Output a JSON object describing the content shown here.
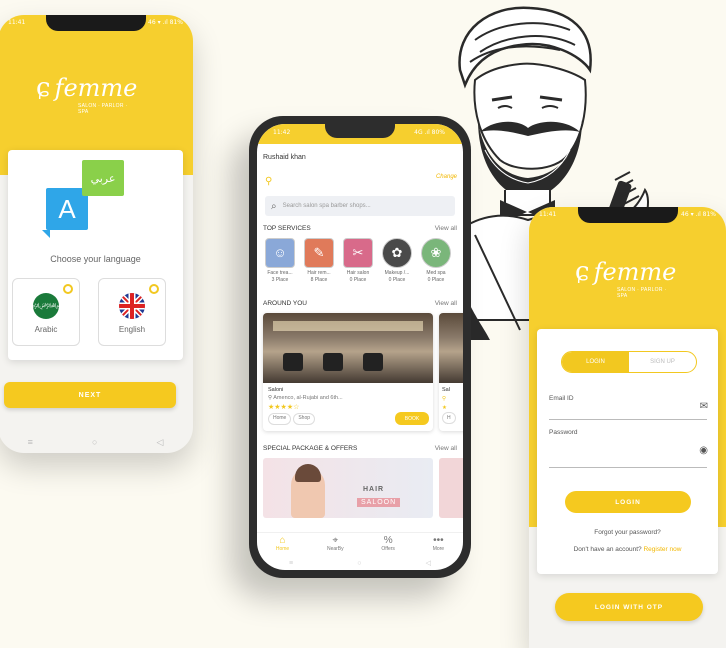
{
  "colors": {
    "accent": "#f6cf2e",
    "background": "#fcfaf1",
    "dark_frame": "#2d2d2d"
  },
  "brand": {
    "name": "femme",
    "tagline": "SALON · PARLOR · SPA"
  },
  "language_screen": {
    "status_left": "11:41",
    "status_right": "46 ▾ .ıl 81%",
    "translate_glyph_en": "A",
    "translate_glyph_ar": "عربي",
    "prompt": "Choose your language",
    "options": [
      {
        "label": "Arabic",
        "flag": "saudi-flag"
      },
      {
        "label": "English",
        "flag": "uk-flag"
      }
    ],
    "next_label": "NEXT"
  },
  "home_screen": {
    "status_left": "11:42",
    "status_right": "4G .ıl 80%",
    "user_name": "Rushaid khan",
    "change_label": "Change",
    "search_placeholder": "Search salon spa barber shops...",
    "top_services": {
      "title": "TOP SERVICES",
      "view_all": "View all",
      "items": [
        {
          "name": "Face trea...",
          "count": "3 Place",
          "color": "#8aa8d8"
        },
        {
          "name": "Hair rem...",
          "count": "8 Place",
          "color": "#e07a5a"
        },
        {
          "name": "Hair salon",
          "count": "0 Place",
          "color": "#d86a8a"
        },
        {
          "name": "Makeup /...",
          "count": "0 Place",
          "color": "#4a4a4a"
        },
        {
          "name": "Med spa",
          "count": "0 Place",
          "color": "#7ab67a"
        }
      ]
    },
    "around_you": {
      "title": "AROUND YOU",
      "view_all": "View all",
      "salon": {
        "name": "Saloni",
        "address": "Amenco, al-Rujabi and 6th...",
        "tags": [
          "Home",
          "Shop"
        ],
        "book_label": "BOOK"
      },
      "salon_partial": {
        "name": "Sal",
        "tag": "H"
      }
    },
    "special": {
      "title": "SPECIAL PACKAGE & OFFERS",
      "view_all": "View all",
      "banner_line1": "HAIR",
      "banner_line2": "SALOON"
    },
    "nav": [
      {
        "label": "Home",
        "icon": "home-icon"
      },
      {
        "label": "NearBy",
        "icon": "nearby-icon"
      },
      {
        "label": "Offers",
        "icon": "offers-icon"
      },
      {
        "label": "More",
        "icon": "more-icon"
      }
    ]
  },
  "login_screen": {
    "status_left": "11:41",
    "status_right": "46 ▾ .ıl 81%",
    "tab_login": "LOGIN",
    "tab_signup": "SIGN UP",
    "email_label": "Email ID",
    "password_label": "Password",
    "login_label": "LOGIN",
    "forgot": "Forgot your password?",
    "no_account": "Don't have an account?",
    "register": "Register now",
    "otp_label": "LOGIN WITH OTP"
  }
}
